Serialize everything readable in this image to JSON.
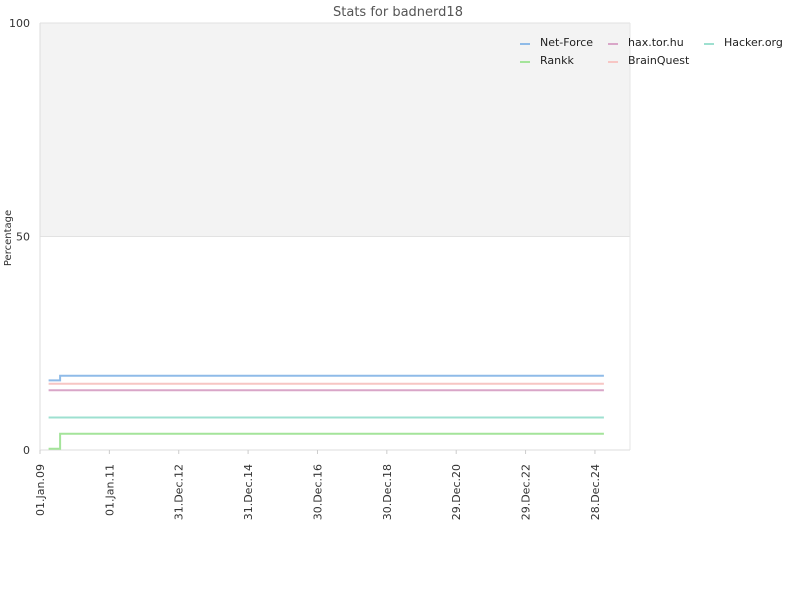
{
  "chart_data": {
    "type": "line",
    "title": "Stats for badnerd18",
    "xlabel": "",
    "ylabel": "Percentage",
    "ylim": [
      0,
      100
    ],
    "yticks": [
      0,
      50,
      100
    ],
    "xlim": [
      "2009-01-01",
      "2026-01-01"
    ],
    "xticks": [
      {
        "label": "01.Jan.09",
        "date": "2009-01-01"
      },
      {
        "label": "01.Jan.11",
        "date": "2011-01-01"
      },
      {
        "label": "31.Dec.12",
        "date": "2012-12-31"
      },
      {
        "label": "31.Dec.14",
        "date": "2014-12-31"
      },
      {
        "label": "30.Dec.16",
        "date": "2016-12-30"
      },
      {
        "label": "30.Dec.18",
        "date": "2018-12-30"
      },
      {
        "label": "29.Dec.20",
        "date": "2020-12-29"
      },
      {
        "label": "29.Dec.22",
        "date": "2022-12-29"
      },
      {
        "label": "28.Dec.24",
        "date": "2024-12-28"
      }
    ],
    "shaded_band": [
      50,
      100
    ],
    "legend_position": "top-right",
    "series": [
      {
        "name": "Net-Force",
        "color": "#8fbbe8",
        "step": true,
        "points": [
          [
            "2009-04-01",
            16.3
          ],
          [
            "2009-08-01",
            16.3
          ],
          [
            "2009-08-01",
            17.4
          ],
          [
            "2025-04-01",
            17.4
          ]
        ]
      },
      {
        "name": "Rankk",
        "color": "#a4e49a",
        "step": true,
        "points": [
          [
            "2009-04-01",
            0.3
          ],
          [
            "2009-08-01",
            0.3
          ],
          [
            "2009-08-01",
            3.8
          ],
          [
            "2025-04-01",
            3.8
          ]
        ]
      },
      {
        "name": "hax.tor.hu",
        "color": "#d9a6c8",
        "step": false,
        "points": [
          [
            "2009-04-01",
            14.0
          ],
          [
            "2025-04-01",
            14.0
          ]
        ]
      },
      {
        "name": "BrainQuest",
        "color": "#f7c6c4",
        "step": false,
        "points": [
          [
            "2009-04-01",
            15.5
          ],
          [
            "2025-04-01",
            15.5
          ]
        ]
      },
      {
        "name": "Hacker.org",
        "color": "#9ee0d0",
        "step": false,
        "points": [
          [
            "2009-04-01",
            7.6
          ],
          [
            "2025-04-01",
            7.6
          ]
        ]
      }
    ]
  }
}
